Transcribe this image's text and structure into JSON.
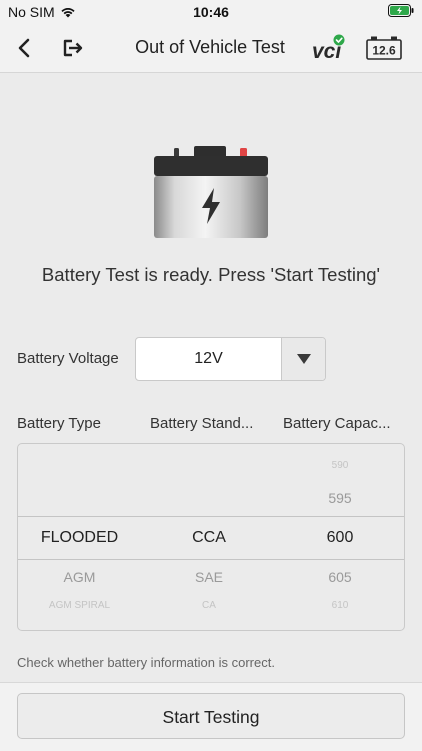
{
  "status_bar": {
    "carrier": "No SIM",
    "time": "10:46"
  },
  "nav": {
    "title": "Out of Vehicle Test",
    "vci_label": "VCI",
    "battery_voltage": "12.6"
  },
  "ready_message": "Battery Test is ready. Press 'Start Testing'",
  "voltage": {
    "label": "Battery Voltage",
    "value": "12V"
  },
  "columns": [
    "Battery Type",
    "Battery Stand...",
    "Battery Capac..."
  ],
  "picker": {
    "rows": [
      {
        "type": "",
        "standard": "",
        "capacity": "590"
      },
      {
        "type": "",
        "standard": "",
        "capacity": "595"
      },
      {
        "type": "FLOODED",
        "standard": "CCA",
        "capacity": "600"
      },
      {
        "type": "AGM",
        "standard": "SAE",
        "capacity": "605"
      },
      {
        "type": "AGM SPIRAL",
        "standard": "CA",
        "capacity": "610"
      }
    ]
  },
  "hint": "Check whether battery information is correct.",
  "start_button": "Start Testing",
  "colors": {
    "accent_green": "#2ea84a",
    "terminal_red": "#e04545",
    "background": "#ebebeb"
  }
}
